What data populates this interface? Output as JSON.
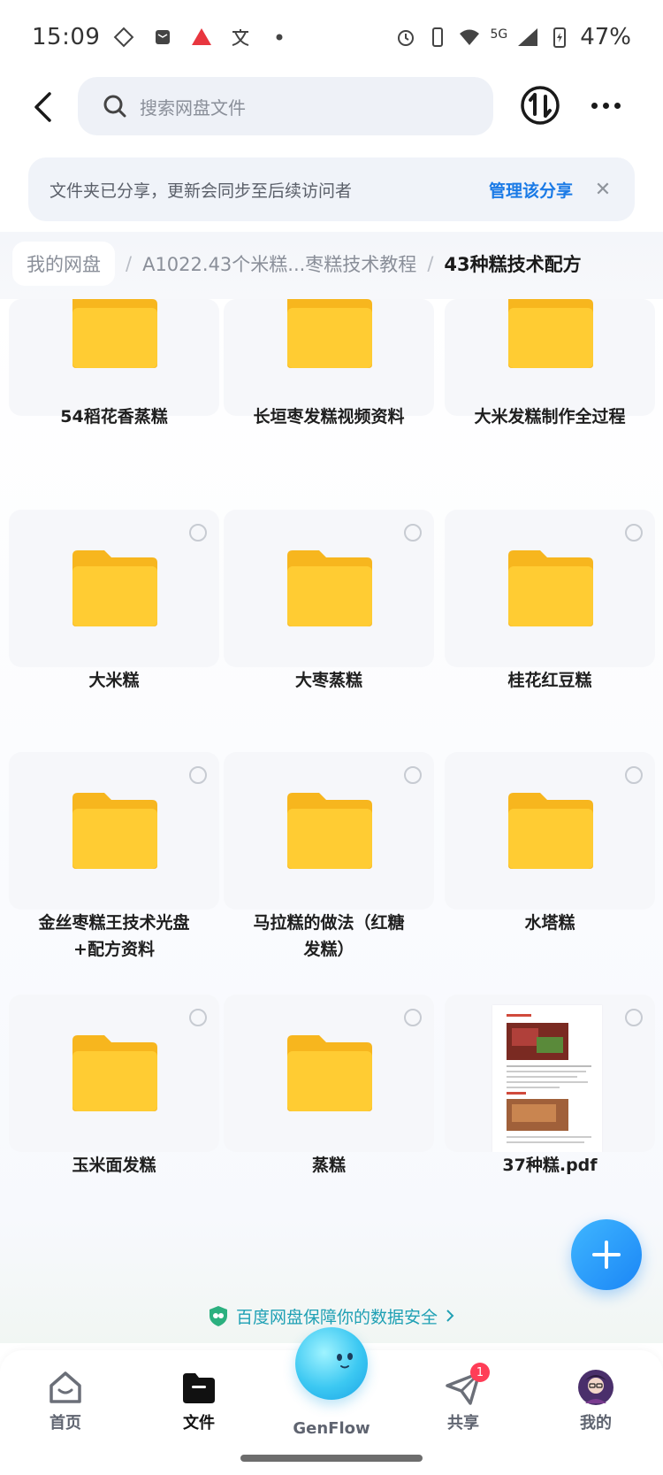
{
  "status_bar": {
    "time": "15:09",
    "network": "5G",
    "battery": "47%"
  },
  "header": {
    "search_placeholder": "搜索网盘文件"
  },
  "share_banner": {
    "message": "文件夹已分享，更新会同步至后续访问者",
    "manage_label": "管理该分享",
    "close_symbol": "✕"
  },
  "breadcrumb": {
    "root": "我的网盘",
    "middle": "A1022.43个米糕...枣糕技术教程",
    "current": "43种糕技术配方",
    "separator": "/"
  },
  "items": [
    {
      "label": "54稻花香蒸糕",
      "type": "folder"
    },
    {
      "label": "长垣枣发糕视频资料",
      "type": "folder"
    },
    {
      "label": "大米发糕制作全过程",
      "type": "folder"
    },
    {
      "label": "大米糕",
      "type": "folder"
    },
    {
      "label": "大枣蒸糕",
      "type": "folder"
    },
    {
      "label": "桂花红豆糕",
      "type": "folder"
    },
    {
      "label": "金丝枣糕王技术光盘+配方资料",
      "line1": "金丝枣糕王技术光盘",
      "line2": "+配方资料",
      "type": "folder"
    },
    {
      "label": "马拉糕的做法（红糖发糕）",
      "line1": "马拉糕的做法（红糖",
      "line2": "发糕）",
      "type": "folder"
    },
    {
      "label": "水塔糕",
      "type": "folder"
    },
    {
      "label": "玉米面发糕",
      "type": "folder"
    },
    {
      "label": "蒸糕",
      "type": "folder"
    },
    {
      "label": "37种糕.pdf",
      "type": "pdf"
    }
  ],
  "security_note": "百度网盘保障你的数据安全",
  "tabs": [
    {
      "label": "首页",
      "icon": "home-icon"
    },
    {
      "label": "文件",
      "icon": "folder-icon",
      "active": true
    },
    {
      "label": "GenFlow",
      "icon": "genflow-orb"
    },
    {
      "label": "共享",
      "icon": "share-icon",
      "badge": "1"
    },
    {
      "label": "我的",
      "icon": "avatar"
    }
  ],
  "colors": {
    "accent": "#1a7ae6",
    "folder_yellow": "#ffc830",
    "security_text": "#1fa0b4",
    "badge": "#ff3d57"
  }
}
